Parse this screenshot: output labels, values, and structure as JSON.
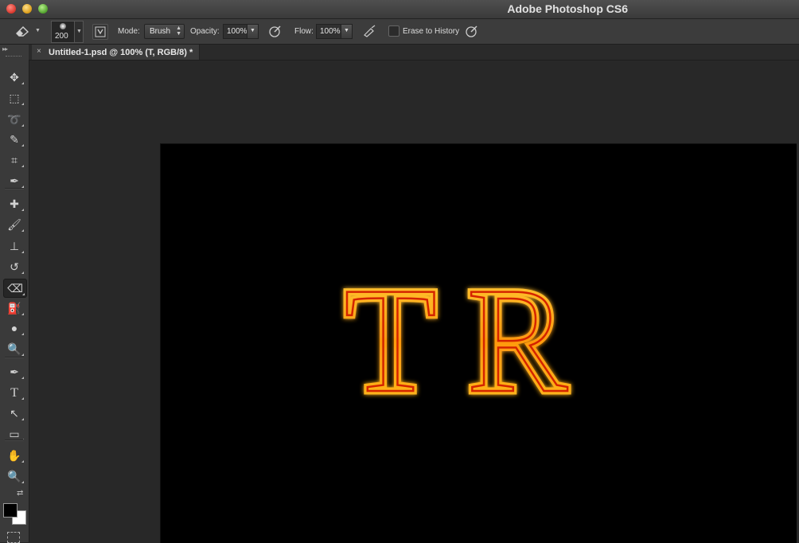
{
  "window": {
    "app_title": "Adobe Photoshop CS6"
  },
  "options": {
    "brush_size": "200",
    "mode_label": "Mode:",
    "mode_value": "Brush",
    "opacity_label": "Opacity:",
    "opacity_value": "100%",
    "flow_label": "Flow:",
    "flow_value": "100%",
    "erase_to_history_label": "Erase to History",
    "erase_to_history_checked": false
  },
  "document": {
    "tab_title": "Untitled-1.psd @ 100% (T, RGB/8) *",
    "close_glyph": "×",
    "canvas_text": "TR",
    "canvas_background": "#000000",
    "text_fill": "#ffa21a",
    "text_stroke": "#ff2a00"
  },
  "toolbar": {
    "active_tool": "eraser",
    "foreground_color": "#000000",
    "background_color": "#ffffff",
    "tools": [
      {
        "name": "move-tool-icon",
        "glyph": "✥"
      },
      {
        "name": "marquee-tool-icon",
        "glyph": "⬚"
      },
      {
        "name": "lasso-tool-icon",
        "glyph": "➰"
      },
      {
        "name": "quick-selection-tool-icon",
        "glyph": "✎"
      },
      {
        "name": "crop-tool-icon",
        "glyph": "⌗"
      },
      {
        "name": "eyedropper-tool-icon",
        "glyph": "✒"
      },
      {
        "name": "healing-brush-tool-icon",
        "glyph": "✚"
      },
      {
        "name": "brush-tool-icon",
        "glyph": "🖌"
      },
      {
        "name": "clone-stamp-tool-icon",
        "glyph": "⊥"
      },
      {
        "name": "history-brush-tool-icon",
        "glyph": "↺"
      },
      {
        "name": "eraser-tool-icon",
        "glyph": "⌫"
      },
      {
        "name": "paint-bucket-tool-icon",
        "glyph": "⛽"
      },
      {
        "name": "blur-tool-icon",
        "glyph": "●"
      },
      {
        "name": "dodge-tool-icon",
        "glyph": "🔍"
      },
      {
        "name": "pen-tool-icon",
        "glyph": "✒"
      },
      {
        "name": "type-tool-icon",
        "glyph": "T"
      },
      {
        "name": "path-selection-tool-icon",
        "glyph": "↖"
      },
      {
        "name": "rectangle-tool-icon",
        "glyph": "▭"
      },
      {
        "name": "hand-tool-icon",
        "glyph": "✋"
      },
      {
        "name": "zoom-tool-icon",
        "glyph": "🔍"
      }
    ]
  }
}
